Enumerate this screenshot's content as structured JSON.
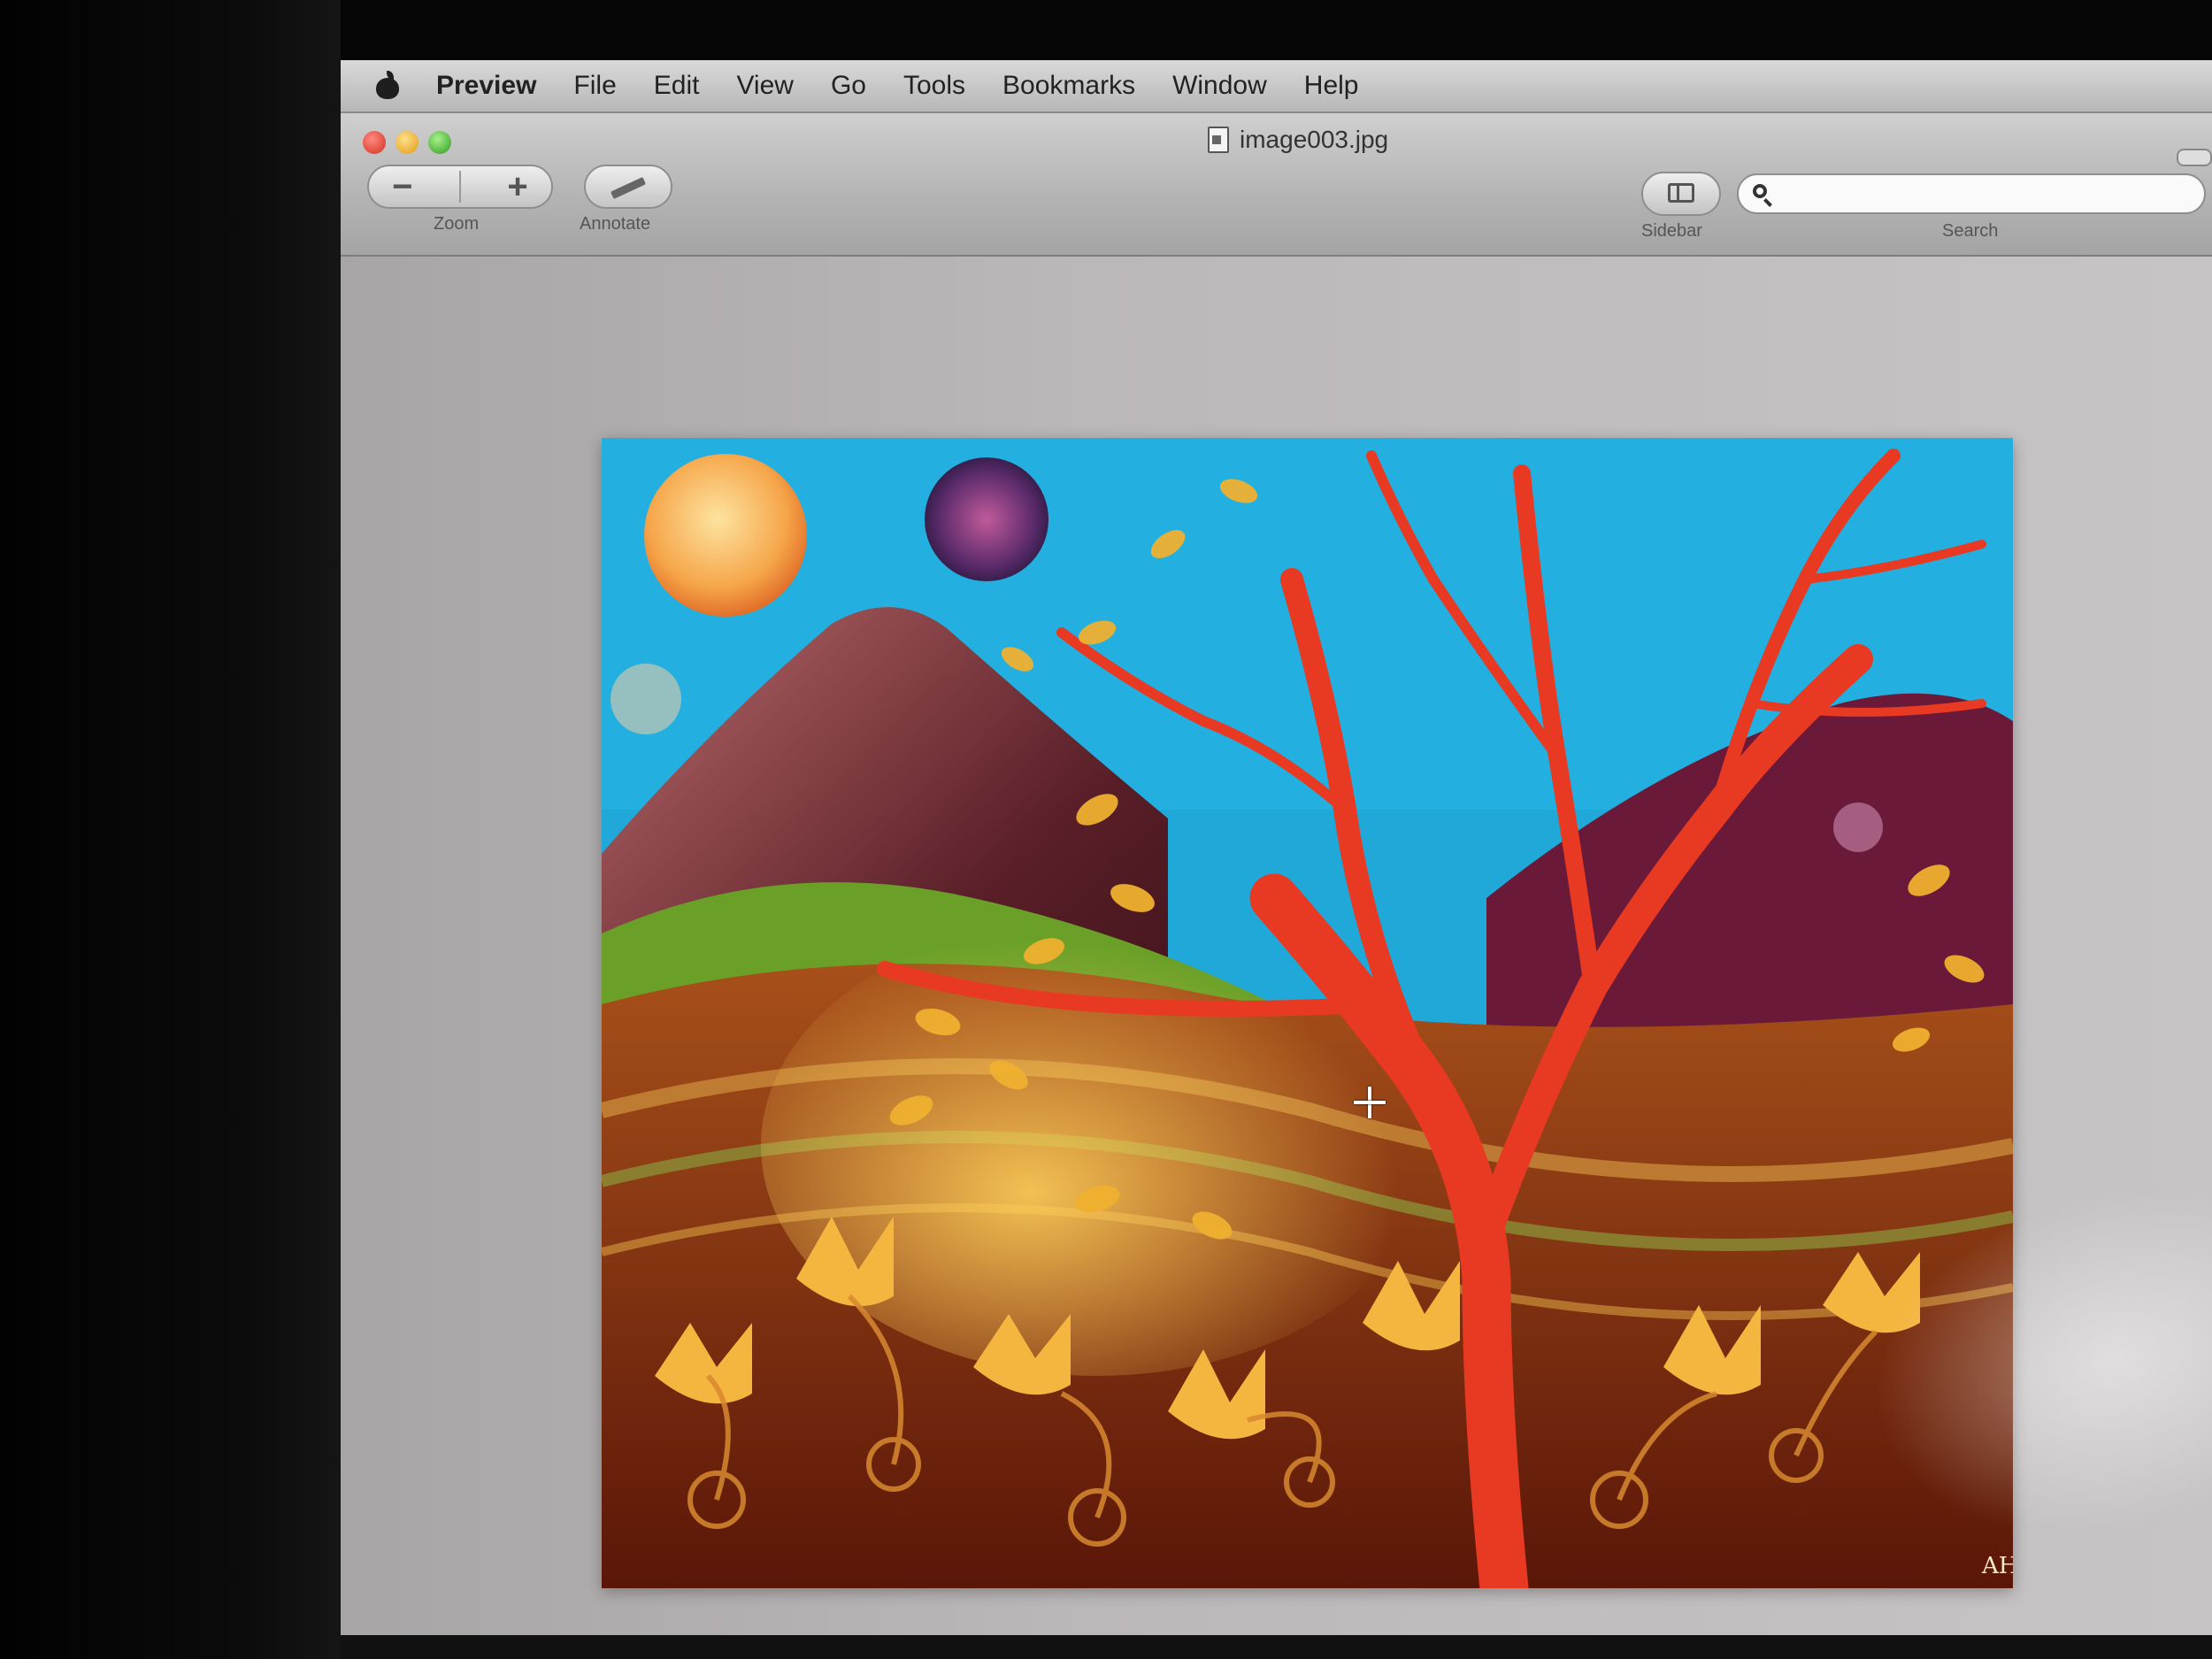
{
  "menubar": {
    "app": "Preview",
    "items": [
      "File",
      "Edit",
      "View",
      "Go",
      "Tools",
      "Bookmarks",
      "Window",
      "Help"
    ]
  },
  "window": {
    "title": "image003.jpg"
  },
  "toolbar": {
    "zoom_out": "−",
    "zoom_in": "+",
    "zoom_label": "Zoom",
    "annotate_label": "Annotate",
    "sidebar_label": "Sidebar",
    "search_label": "Search",
    "search_value": ""
  },
  "document": {
    "signature": "AH"
  },
  "colors": {
    "sky": "#1fa8d8",
    "tree": "#e83a22",
    "leaves": "#f0b030",
    "ground": "#7a2410"
  }
}
